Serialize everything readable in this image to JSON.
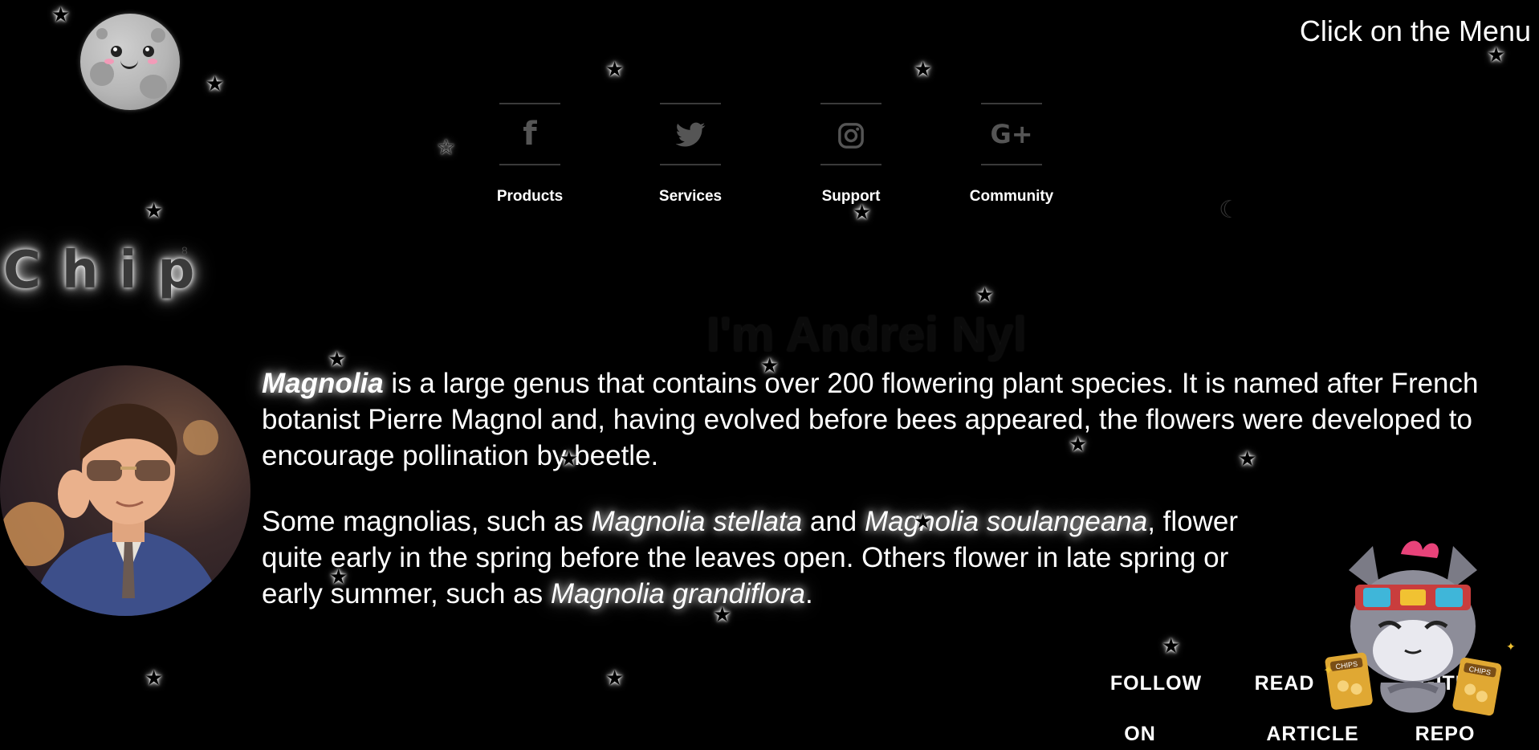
{
  "header": {
    "menu_hint": "Click on the Menu"
  },
  "nav": {
    "items": [
      {
        "label": "Products",
        "icon": "facebook-icon",
        "glyph": "f"
      },
      {
        "label": "Services",
        "icon": "twitter-icon",
        "glyph": "🐦"
      },
      {
        "label": "Support",
        "icon": "instagram-icon",
        "glyph": "◎"
      },
      {
        "label": "Community",
        "icon": "google-plus-icon",
        "glyph": "G+"
      }
    ]
  },
  "brand": {
    "chip_text": "Chip",
    "chip_superscript": "8"
  },
  "hero": {
    "headline": "I'm Andrei Nyl"
  },
  "content": {
    "p1": {
      "term": "Magnolia",
      "text": " is a large genus that contains over 200 flowering plant species. It is named after French botanist Pierre Magnol and, having evolved before bees appeared, the flowers were developed to encourage pollination by beetle."
    },
    "p2": {
      "t1": "Some magnolias, such as ",
      "s1": "Magnolia stellata",
      "t2": " and ",
      "s2": "Magnolia soulangeana",
      "t3": ", flower quite early in the spring before the leaves open. Others flower in late spring or early summer, such as ",
      "s3": "Magnolia grandiflora",
      "t4": "."
    }
  },
  "footer_links": [
    {
      "line1": "FOLLOW",
      "line2": "ON"
    },
    {
      "line1": "READ",
      "line2": "ARTICLE"
    },
    {
      "line1": "GITH",
      "line2": "REPO"
    }
  ],
  "decor": {
    "mascot_bag_label": "CHIPS",
    "colors": {
      "background": "#000000",
      "text": "#ffffff",
      "icon": "#555555"
    }
  }
}
